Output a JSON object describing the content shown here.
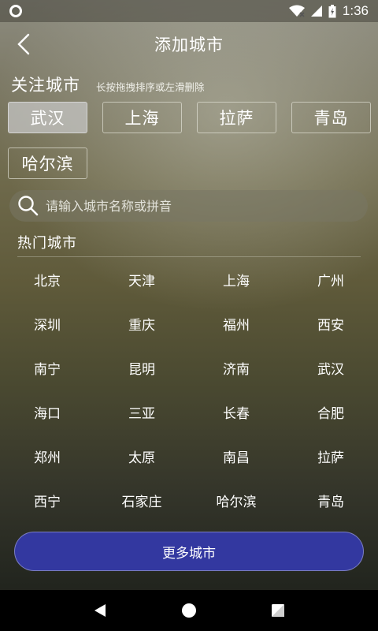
{
  "status_bar": {
    "time": "1:36",
    "icons": [
      "circle-icon",
      "wifi-icon",
      "signal-icon",
      "battery-icon"
    ]
  },
  "header": {
    "title": "添加城市",
    "back_icon": "chevron-left-icon"
  },
  "followed": {
    "title": "关注城市",
    "hint": "长按拖拽排序或左滑删除",
    "cities": [
      "武汉",
      "上海",
      "拉萨",
      "青岛",
      "哈尔滨"
    ],
    "active_index": 0
  },
  "search": {
    "placeholder": "请输入城市名称或拼音",
    "icon": "search-icon"
  },
  "hot": {
    "title": "热门城市",
    "cities": [
      "北京",
      "天津",
      "上海",
      "广州",
      "深圳",
      "重庆",
      "福州",
      "西安",
      "南宁",
      "昆明",
      "济南",
      "武汉",
      "海口",
      "三亚",
      "长春",
      "合肥",
      "郑州",
      "太原",
      "南昌",
      "拉萨",
      "西宁",
      "石家庄",
      "哈尔滨",
      "青岛"
    ]
  },
  "more_button": {
    "label": "更多城市",
    "color": "#3338a0"
  },
  "nav": {
    "icons": [
      "back-triangle-icon",
      "home-circle-icon",
      "recents-square-icon"
    ]
  }
}
